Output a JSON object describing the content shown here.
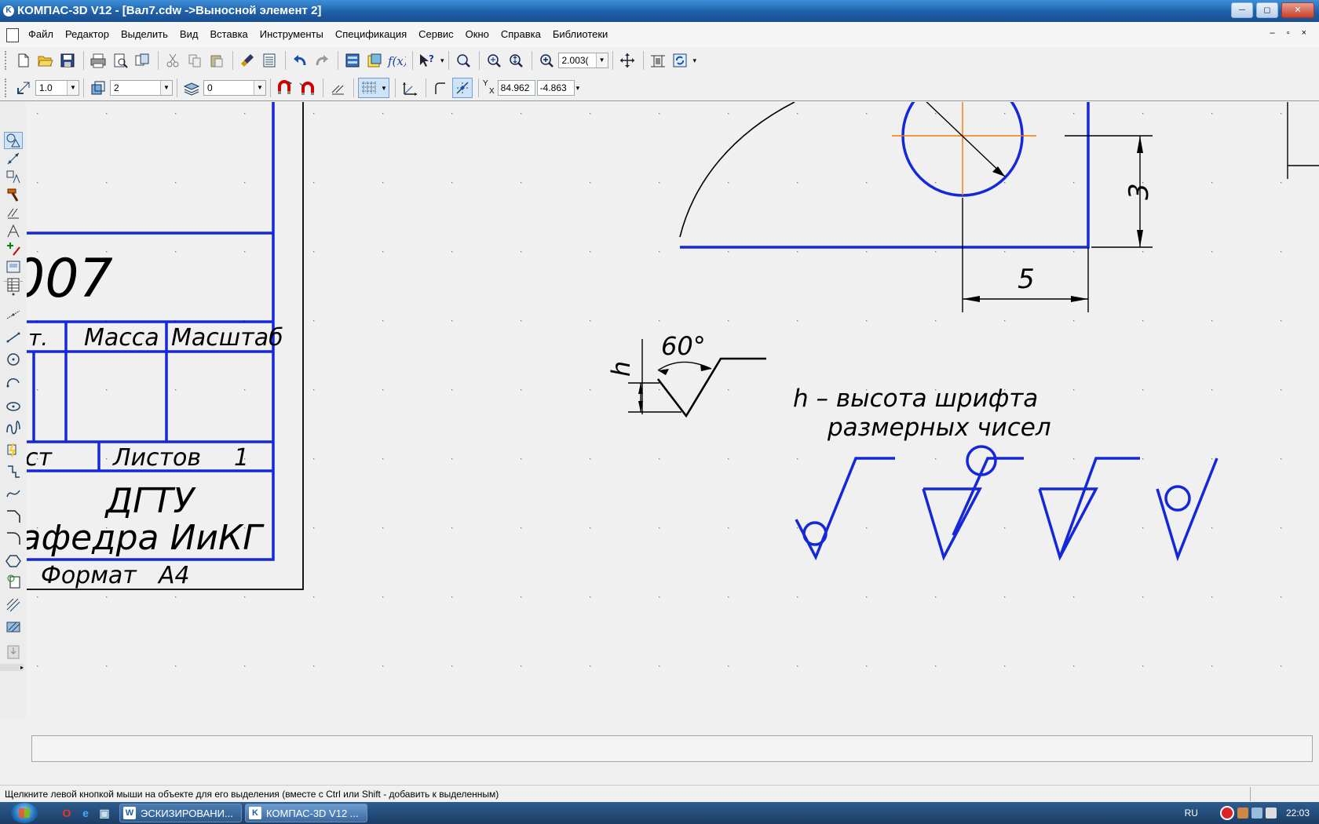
{
  "window": {
    "title": "КОМПАС-3D V12 - [Вал7.cdw ->Выносной элемент 2]",
    "buttons": {
      "minimize": "─",
      "maximize": "◻",
      "close": "✕"
    }
  },
  "menu": {
    "items": [
      "Файл",
      "Редактор",
      "Выделить",
      "Вид",
      "Вставка",
      "Инструменты",
      "Спецификация",
      "Сервис",
      "Окно",
      "Справка",
      "Библиотеки"
    ],
    "mdi_buttons": "– ▫ ×"
  },
  "toolbar_standard": {
    "zoom_value": "2.003("
  },
  "toolbar_current_state": {
    "step": "1.0",
    "layer_view": "2",
    "layer": "0",
    "coord_label_y": "Y",
    "coord_label_x": "X",
    "coord_x": "84.962",
    "coord_y": "-4.863"
  },
  "drawing": {
    "title_block": {
      "code_fragment": "007",
      "lit_fragment": "т.",
      "mass_label": "Масса",
      "scale_label": "Масштаб",
      "sheet_fragment": "ст",
      "sheets_label": "Листов",
      "sheets_count": "1",
      "org_line1": "ДГТУ",
      "org_line2": "Кафедра ИиКГ",
      "format_label": "Формат",
      "format_value": "А4"
    },
    "dimensions": {
      "vertical": "3",
      "horizontal": "5"
    },
    "roughness": {
      "angle_label": "60°",
      "height_symbol": "h",
      "note_line1": "h – высота шрифта",
      "note_line2": "размерных чисел"
    },
    "colors": {
      "main_line": "#1428d8",
      "thin_line": "#000000",
      "axis_line": "#f07800"
    }
  },
  "status": {
    "message": "Щелкните левой кнопкой мыши на объекте для его выделения (вместе с Ctrl или Shift - добавить к выделенным)"
  },
  "taskbar": {
    "tasks": [
      "ЭСКИЗИРОВАНИ...",
      "КОМПАС-3D V12 ..."
    ],
    "language": "RU",
    "time": "22:03"
  }
}
